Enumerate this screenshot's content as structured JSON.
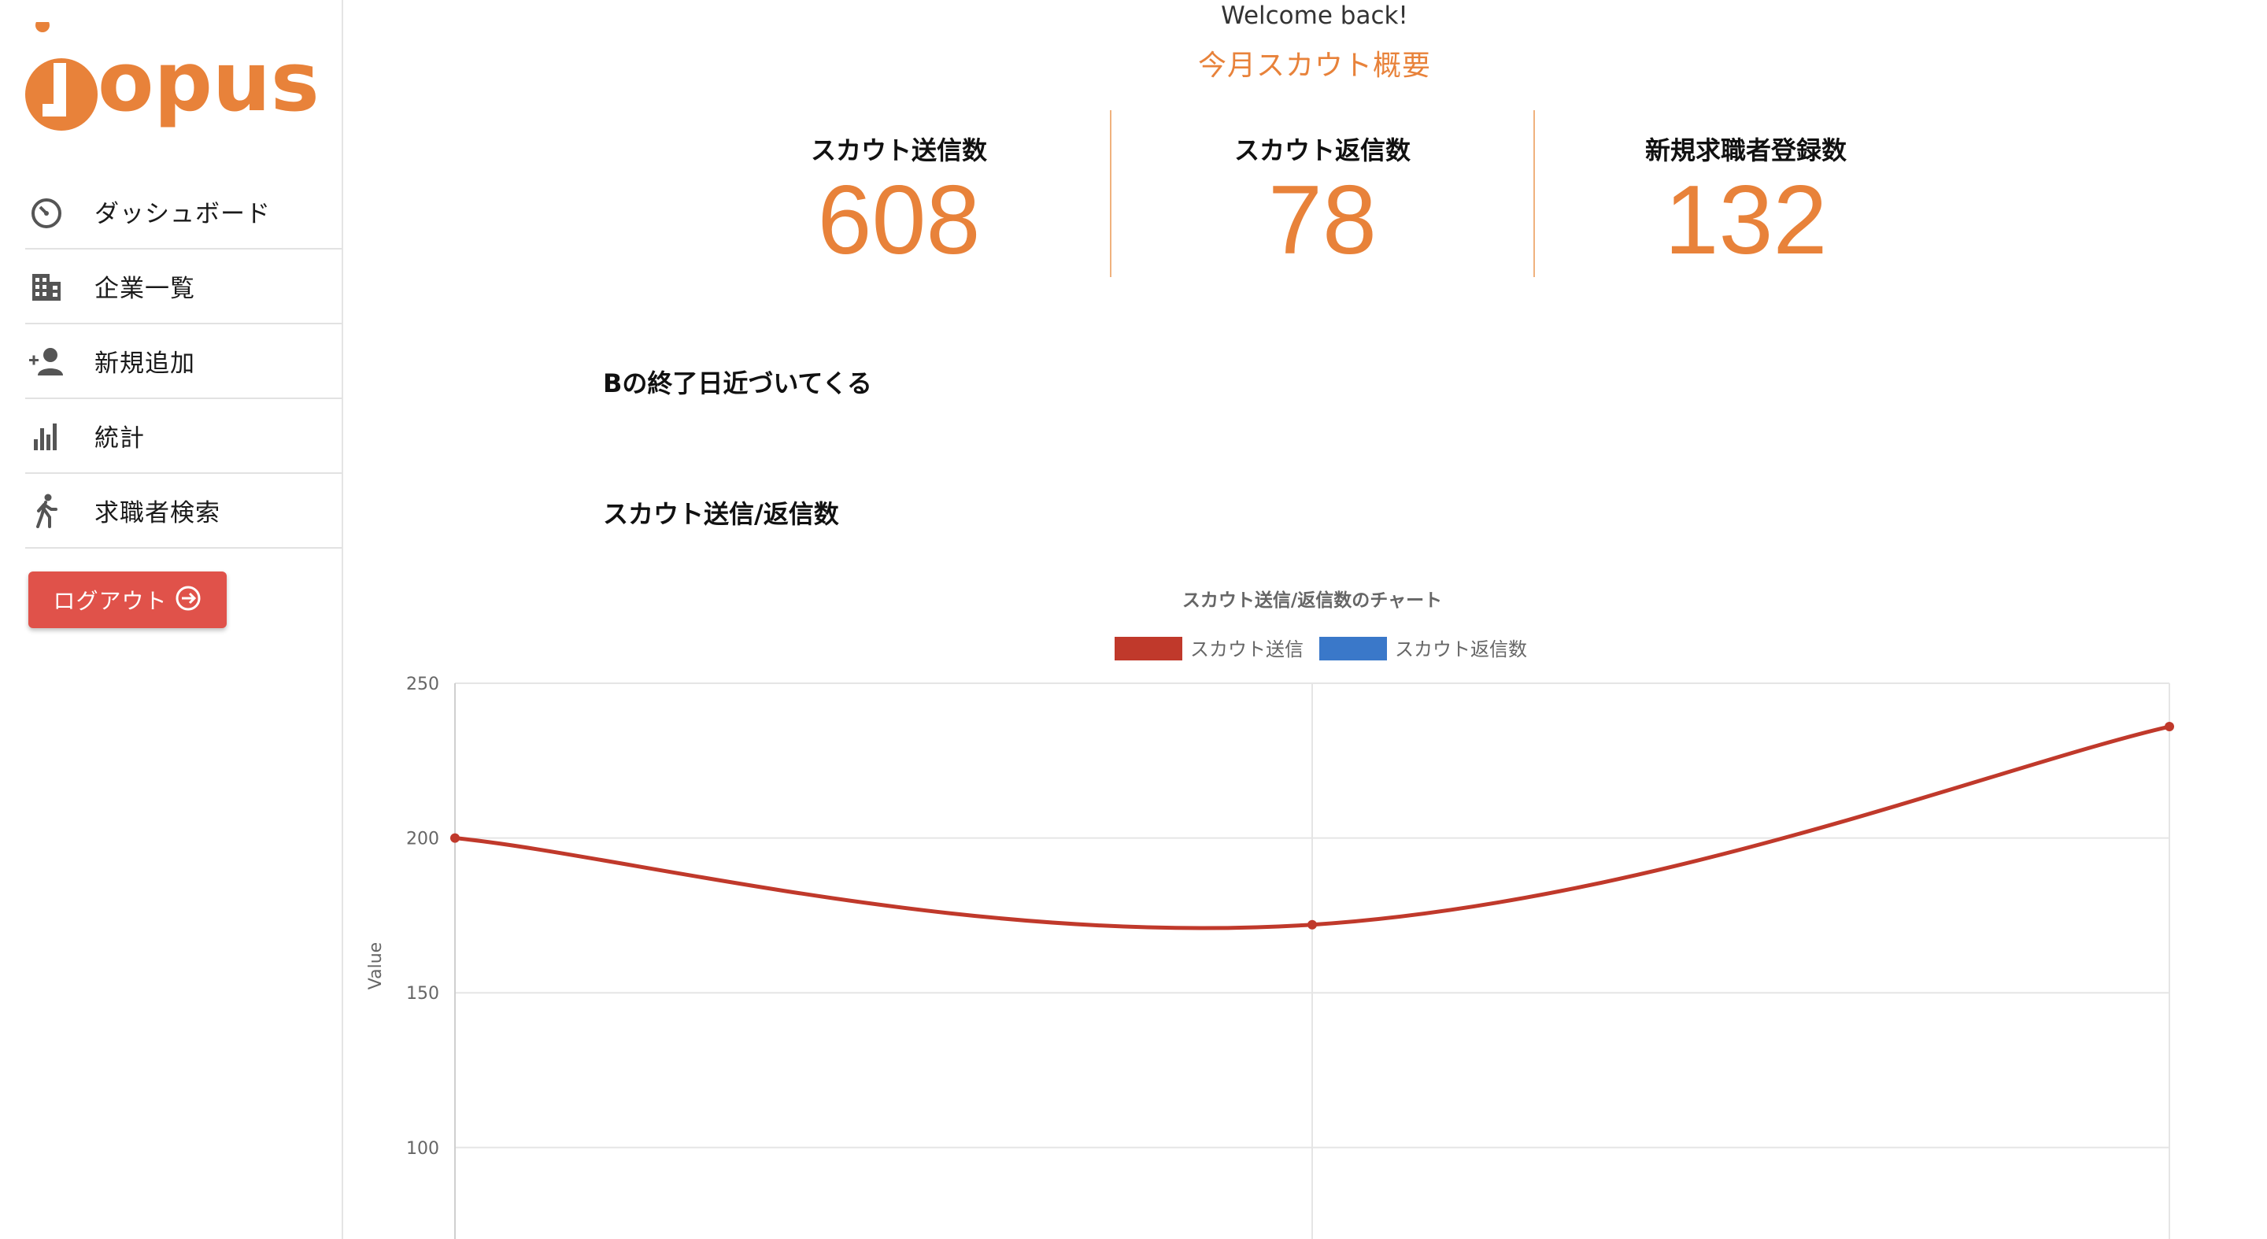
{
  "sidebar": {
    "logo_text": "jopus",
    "nav": [
      {
        "label": "ダッシュボード",
        "icon": "speedometer-icon"
      },
      {
        "label": "企業一覧",
        "icon": "building-icon"
      },
      {
        "label": "新規追加",
        "icon": "add-person-icon"
      },
      {
        "label": "統計",
        "icon": "bar-chart-icon"
      },
      {
        "label": "求職者検索",
        "icon": "walking-person-icon"
      }
    ],
    "logout_label": "ログアウト"
  },
  "header": {
    "welcome": "Welcome back!",
    "subtitle": "今月スカウト概要"
  },
  "stats": [
    {
      "label": "スカウト送信数",
      "value": "608"
    },
    {
      "label": "スカウト返信数",
      "value": "78"
    },
    {
      "label": "新規求職者登録数",
      "value": "132"
    }
  ],
  "sections": {
    "notice_title": "Bの終了日近づいてくる",
    "chart_section_title": "スカウト送信/返信数"
  },
  "colors": {
    "accent": "#e8823a",
    "logout": "#e0524a",
    "series_sent": "#c0392b",
    "series_replied": "#3a78c9"
  },
  "chart_data": {
    "type": "line",
    "title": "スカウト送信/返信数のチャート",
    "ylabel": "Value",
    "xlabel": "",
    "x": [
      "",
      "",
      ""
    ],
    "ylim": [
      75,
      250
    ],
    "yticks": [
      100,
      150,
      200,
      250
    ],
    "grid": true,
    "legend": "top-center",
    "series": [
      {
        "name": "スカウト送信",
        "color": "#c0392b",
        "values": [
          200,
          172,
          236
        ]
      },
      {
        "name": "スカウト返信数",
        "color": "#3a78c9",
        "values": []
      }
    ]
  }
}
